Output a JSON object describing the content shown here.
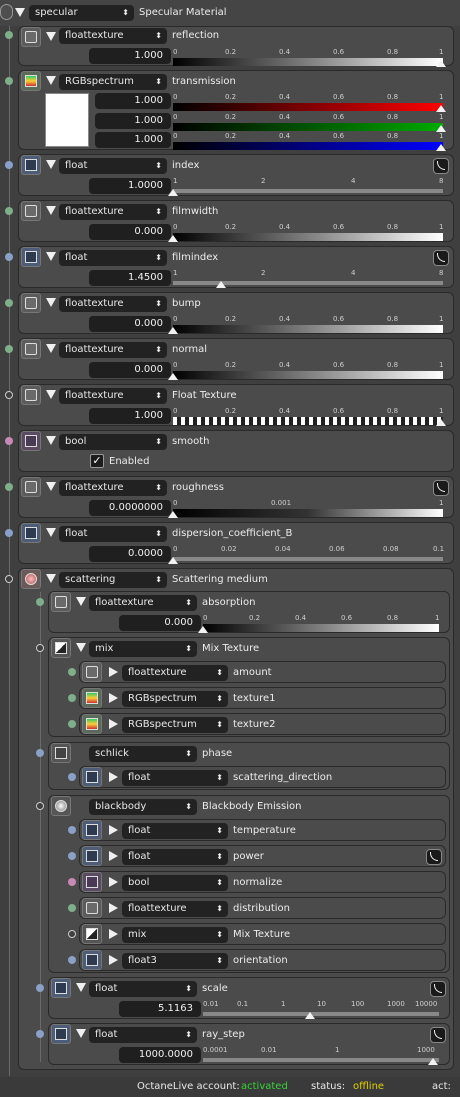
{
  "root": {
    "type": "specular",
    "label": "Specular Material"
  },
  "slider_ticks": {
    "unit": [
      "0",
      "0.2",
      "0.4",
      "0.6",
      "0.8",
      "1"
    ],
    "index": [
      "1",
      "2",
      "4",
      "8"
    ],
    "roughness": [
      "0",
      "0.001",
      "1"
    ],
    "dispersion": [
      "0",
      "0.02",
      "0.04",
      "0.06",
      "0.08",
      "0.1"
    ],
    "scale": [
      "0.01",
      "0.1",
      "1",
      "10",
      "100",
      "1000",
      "10000"
    ],
    "ray_step": [
      "0.0001",
      "0.01",
      "1",
      "1000"
    ]
  },
  "params": {
    "reflection": {
      "type": "floattexture",
      "label": "reflection",
      "value": "1.000",
      "level": 1.0
    },
    "transmission": {
      "type": "RGBspectrum",
      "label": "transmission",
      "r": "1.000",
      "g": "1.000",
      "b": "1.000",
      "level": 1.0
    },
    "index": {
      "type": "float",
      "label": "index",
      "value": "1.0000",
      "level": 1.0
    },
    "filmwidth": {
      "type": "floattexture",
      "label": "filmwidth",
      "value": "0.000",
      "level": 0.0
    },
    "filmindex": {
      "type": "float",
      "label": "filmindex",
      "value": "1.4500",
      "level": 1.45
    },
    "bump": {
      "type": "floattexture",
      "label": "bump",
      "value": "0.000",
      "level": 0.0
    },
    "normal": {
      "type": "floattexture",
      "label": "normal",
      "value": "0.000",
      "level": 0.0
    },
    "float_texture": {
      "type": "floattexture",
      "label": "Float Texture",
      "value": "1.000",
      "level": 1.0
    },
    "smooth": {
      "type": "bool",
      "label": "smooth",
      "check_label": "Enabled",
      "checked": true
    },
    "roughness": {
      "type": "floattexture",
      "label": "roughness",
      "value": "0.0000000",
      "level": 0.0
    },
    "dispersion": {
      "type": "float",
      "label": "dispersion_coefficient_B",
      "value": "0.0000",
      "level": 0.0
    }
  },
  "scattering": {
    "type": "scattering",
    "label": "Scattering medium",
    "absorption": {
      "type": "floattexture",
      "label": "absorption",
      "value": "0.000",
      "level": 0.0
    },
    "mix": {
      "type": "mix",
      "label": "Mix Texture",
      "items": [
        {
          "type": "floattexture",
          "label": "amount"
        },
        {
          "type": "RGBspectrum",
          "label": "texture1"
        },
        {
          "type": "RGBspectrum",
          "label": "texture2"
        }
      ]
    },
    "phase": {
      "type": "schlick",
      "label": "phase",
      "sub": {
        "type": "float",
        "label": "scattering_direction"
      }
    },
    "emission": {
      "type": "blackbody",
      "label": "Blackbody Emission",
      "items": [
        {
          "type": "float",
          "label": "temperature"
        },
        {
          "type": "float",
          "label": "power"
        },
        {
          "type": "bool",
          "label": "normalize"
        },
        {
          "type": "floattexture",
          "label": "distribution"
        },
        {
          "type": "mix",
          "label": "Mix Texture"
        },
        {
          "type": "float3",
          "label": "orientation"
        }
      ]
    },
    "scale": {
      "type": "float",
      "label": "scale",
      "value": "5.1163"
    },
    "ray_step": {
      "type": "float",
      "label": "ray_step",
      "value": "1000.0000"
    }
  },
  "status": {
    "account_label": "OctaneLive account:",
    "account_value": "activated",
    "status_label": "status:",
    "status_value": "offline",
    "act_label": "act:"
  },
  "colors": {
    "dot_green": "#7fae8a",
    "dot_blue": "#8aa0c8",
    "dot_pink": "#c88ab4",
    "activated": "#35d435",
    "offline": "#e0d000"
  }
}
